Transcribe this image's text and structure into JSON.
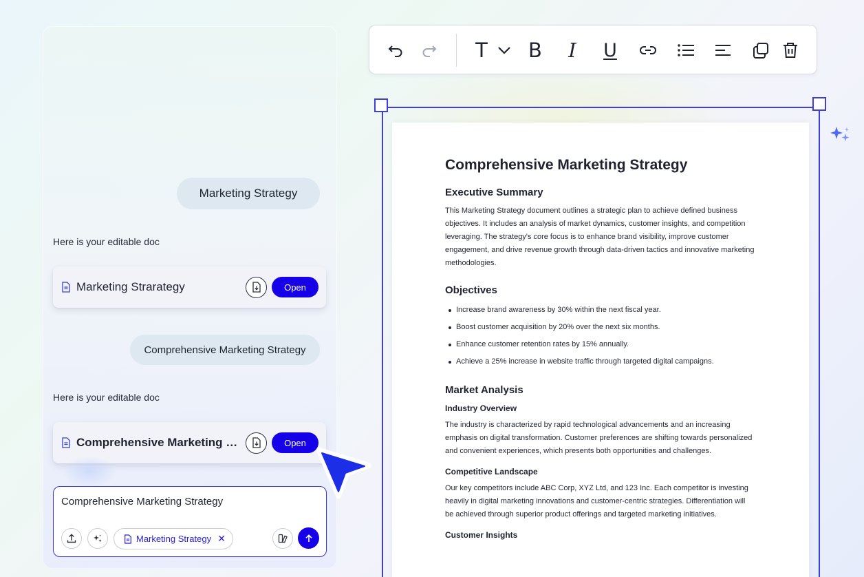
{
  "chat": {
    "messages": [
      {
        "role": "user",
        "text": "Marketing Strategy"
      },
      {
        "role": "assistant",
        "text": "Here is your editable doc",
        "card": {
          "title": "Marketing Strarategy",
          "open_label": "Open"
        }
      },
      {
        "role": "user",
        "text": "Comprehensive Marketing Strategy"
      },
      {
        "role": "assistant",
        "text": "Here is your editable doc",
        "card": {
          "title": "Comprehensive Marketing Strategy",
          "open_label": "Open"
        }
      }
    ],
    "composer": {
      "value": "Comprehensive Marketing Strategy",
      "chip_label": "Marketing Strategy",
      "chip_close": "✕"
    }
  },
  "toolbar": {
    "tools": [
      "undo-icon",
      "redo-icon",
      "text-style-icon",
      "chevron-down-icon",
      "bold-icon",
      "italic-icon",
      "underline-icon",
      "link-icon",
      "bullet-list-icon",
      "align-left-icon",
      "duplicate-icon",
      "delete-icon"
    ],
    "text_style_letter": "T",
    "bold_letter": "B",
    "italic_letter": "I",
    "underline_letter": "U"
  },
  "document": {
    "title": "Comprehensive Marketing Strategy",
    "executive_summary": {
      "heading": "Executive Summary",
      "body": "This Marketing Strategy document outlines a strategic plan to achieve defined business objectives. It includes an analysis of market dynamics, customer insights, and competition leveraging. The strategy's core focus is to enhance brand visibility, improve customer engagement, and drive revenue growth through data-driven tactics and innovative marketing methodologies."
    },
    "objectives": {
      "heading": "Objectives",
      "items": [
        "Increase brand awareness by 30% within the next fiscal year.",
        "Boost customer acquisition by 20% over the next six months.",
        "Enhance customer retention rates by 15% annually.",
        "Achieve a 25% increase in website traffic through targeted digital campaigns."
      ]
    },
    "market_analysis": {
      "heading": "Market Analysis",
      "industry_overview": {
        "heading": "Industry Overview",
        "body": "The industry is characterized by rapid technological advancements and an increasing emphasis on digital transformation. Customer preferences are shifting towards personalized and convenient experiences, which presents both opportunities and challenges."
      },
      "competitive_landscape": {
        "heading": "Competitive Landscape",
        "body": "Our key competitors include ABC Corp, XYZ Ltd, and 123 Inc. Each competitor is investing heavily in digital marketing innovations and customer-centric strategies. Differentiation will be achieved through superior product offerings and targeted marketing initiatives."
      },
      "customer_insights": {
        "heading": "Customer Insights"
      }
    }
  },
  "colors": {
    "accent": "#1500e8",
    "selection": "#3d3de0",
    "bubble": "#dde8f0"
  }
}
